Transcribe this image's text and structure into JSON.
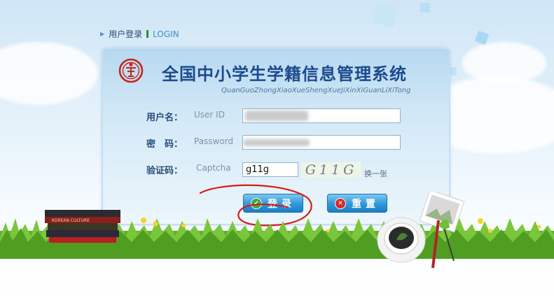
{
  "breadcrumb": {
    "cn": "用户登录",
    "en": "LOGIN"
  },
  "system": {
    "title": "全国中小学生学籍信息管理系统",
    "pinyin": "QuanGuoZhongXiaoXueShengXueJiXinXiGuanLiXiTong"
  },
  "form": {
    "username": {
      "label_cn": "用户名：",
      "label_en": "User ID",
      "value": ""
    },
    "password": {
      "label_cn": "密　码：",
      "label_en": "Password",
      "value": ""
    },
    "captcha": {
      "label_cn": "验证码：",
      "label_en": "Captcha",
      "value": "g11g",
      "image_text": "G11G",
      "refresh_label": "换一张"
    }
  },
  "buttons": {
    "login": "登录",
    "reset": "重置"
  },
  "books": {
    "spine_text": "KOREAN CULTURE"
  },
  "colors": {
    "title": "#1d4a8f",
    "button": "#2f97d8",
    "accent_green": "#2f8a3b"
  }
}
